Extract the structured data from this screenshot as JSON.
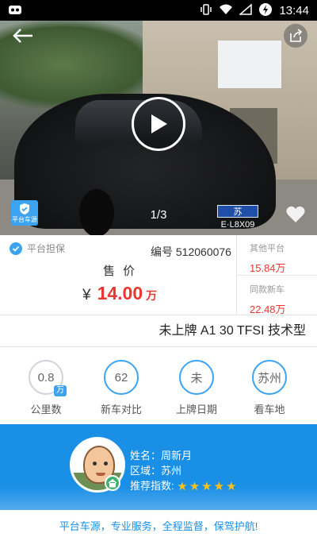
{
  "status_bar": {
    "time": "13:44"
  },
  "gallery": {
    "page_indicator": "1/3",
    "platform_badge": "平台车源",
    "plate_text": "苏E·L8X09"
  },
  "price_panel": {
    "guarantee_label": "平台担保",
    "serial": "编号 512060076",
    "sale_label": "售 价",
    "currency": "¥",
    "price": "14.00",
    "price_unit": "万"
  },
  "compare": {
    "other_platform_label": "其他平台",
    "other_platform_price": "15.84万",
    "new_car_label": "同款新车",
    "new_car_price": "22.48万"
  },
  "model_title": "未上牌  A1 30 TFSI 技术型",
  "stats": [
    {
      "value": "0.8",
      "unit": "万",
      "caption": "公里数"
    },
    {
      "value": "62",
      "caption": "新车对比"
    },
    {
      "value": "未",
      "caption": "上牌日期"
    },
    {
      "value": "苏州",
      "caption": "看车地"
    }
  ],
  "agent": {
    "name": "姓名：周新月",
    "region": "区域：苏州",
    "rating_label": "推荐指数:",
    "stars": 5
  },
  "slogan": "平台车源，专业服务，全程监督，保驾护航!",
  "colors": {
    "accent": "#1a8fe6",
    "price": "#e8382f",
    "star": "#f6c21c"
  }
}
